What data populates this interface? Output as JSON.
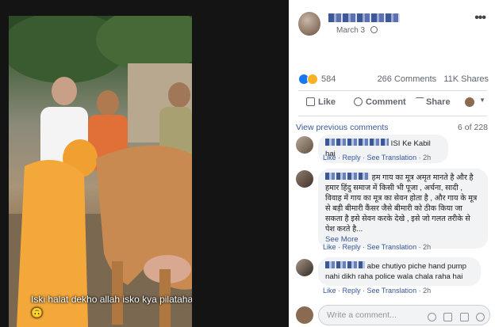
{
  "photo": {
    "caption": "Iski halat dekho allah isko kya pilatahai🙃"
  },
  "post": {
    "date": "March 3",
    "more_icon": "•••",
    "reaction_count": "584",
    "comments_count": "266 Comments",
    "shares_count": "11K Shares"
  },
  "actions": {
    "like": "Like",
    "comment": "Comment",
    "share": "Share"
  },
  "comments_section": {
    "view_previous": "View previous comments",
    "count": "6 of 228",
    "items": [
      {
        "text": "ISI Ke Kabil hai",
        "like": "Like",
        "reply": "Reply",
        "see_translation": "See Translation",
        "time": "2h"
      },
      {
        "text": "हम गाय का मूत्र अमृत मानते है और है हमार हिंदु समाज में किसी भी पूजा , अर्चना, सादी , विवाह में गाय का मूत्र का सेवन होता है , और गाय के मूत्र से बड़ी बीमारी कैंसर जैसे बीमारी को ठीक किया जा सकता है इसे सेवन करके देखे , इसे जो गलत तरीके से पेश करते है...",
        "see_more": "See More",
        "like": "Like",
        "reply": "Reply",
        "see_translation": "See Translation",
        "time": "2h"
      },
      {
        "text": "abe chutiyo piche hand pump nahi dikh raha police wala chala raha hai",
        "like": "Like",
        "reply": "Reply",
        "see_translation": "See Translation",
        "time": "2h"
      }
    ]
  },
  "write_comment": {
    "placeholder": "Write a comment..."
  }
}
